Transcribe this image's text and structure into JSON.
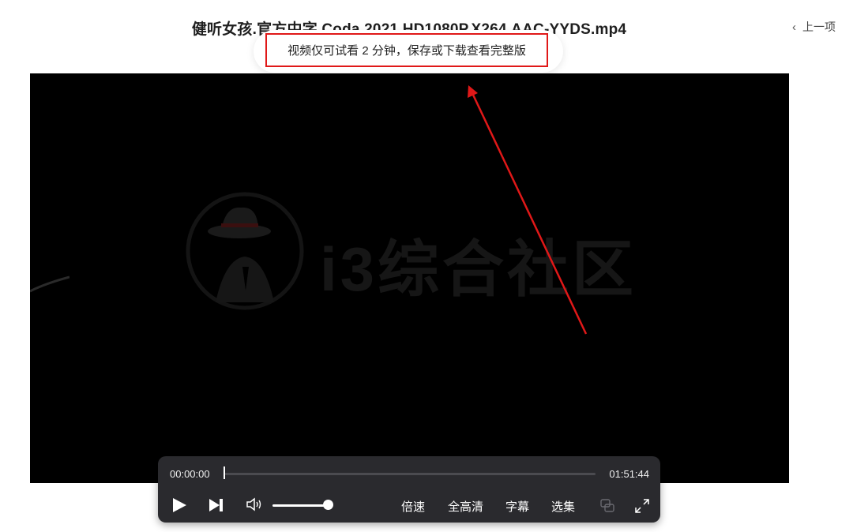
{
  "header": {
    "title": "健听女孩.官方中字.Coda.2021.HD1080P.X264.AAC-YYDS.mp4",
    "prev_label": "上一项"
  },
  "notice": {
    "text": "视频仅可试看 2 分钟，保存或下载查看完整版"
  },
  "video": {
    "watermark_text": "i3综合社区"
  },
  "player": {
    "current_time": "00:00:00",
    "total_time": "01:51:44",
    "progress": 0.0,
    "volume": 1.0,
    "speed_label": "倍速",
    "quality_label": "全高清",
    "subtitle_label": "字幕",
    "episodes_label": "选集"
  },
  "colors": {
    "annotation_red": "#e01818",
    "controls_bg": "#2a2a2e"
  }
}
